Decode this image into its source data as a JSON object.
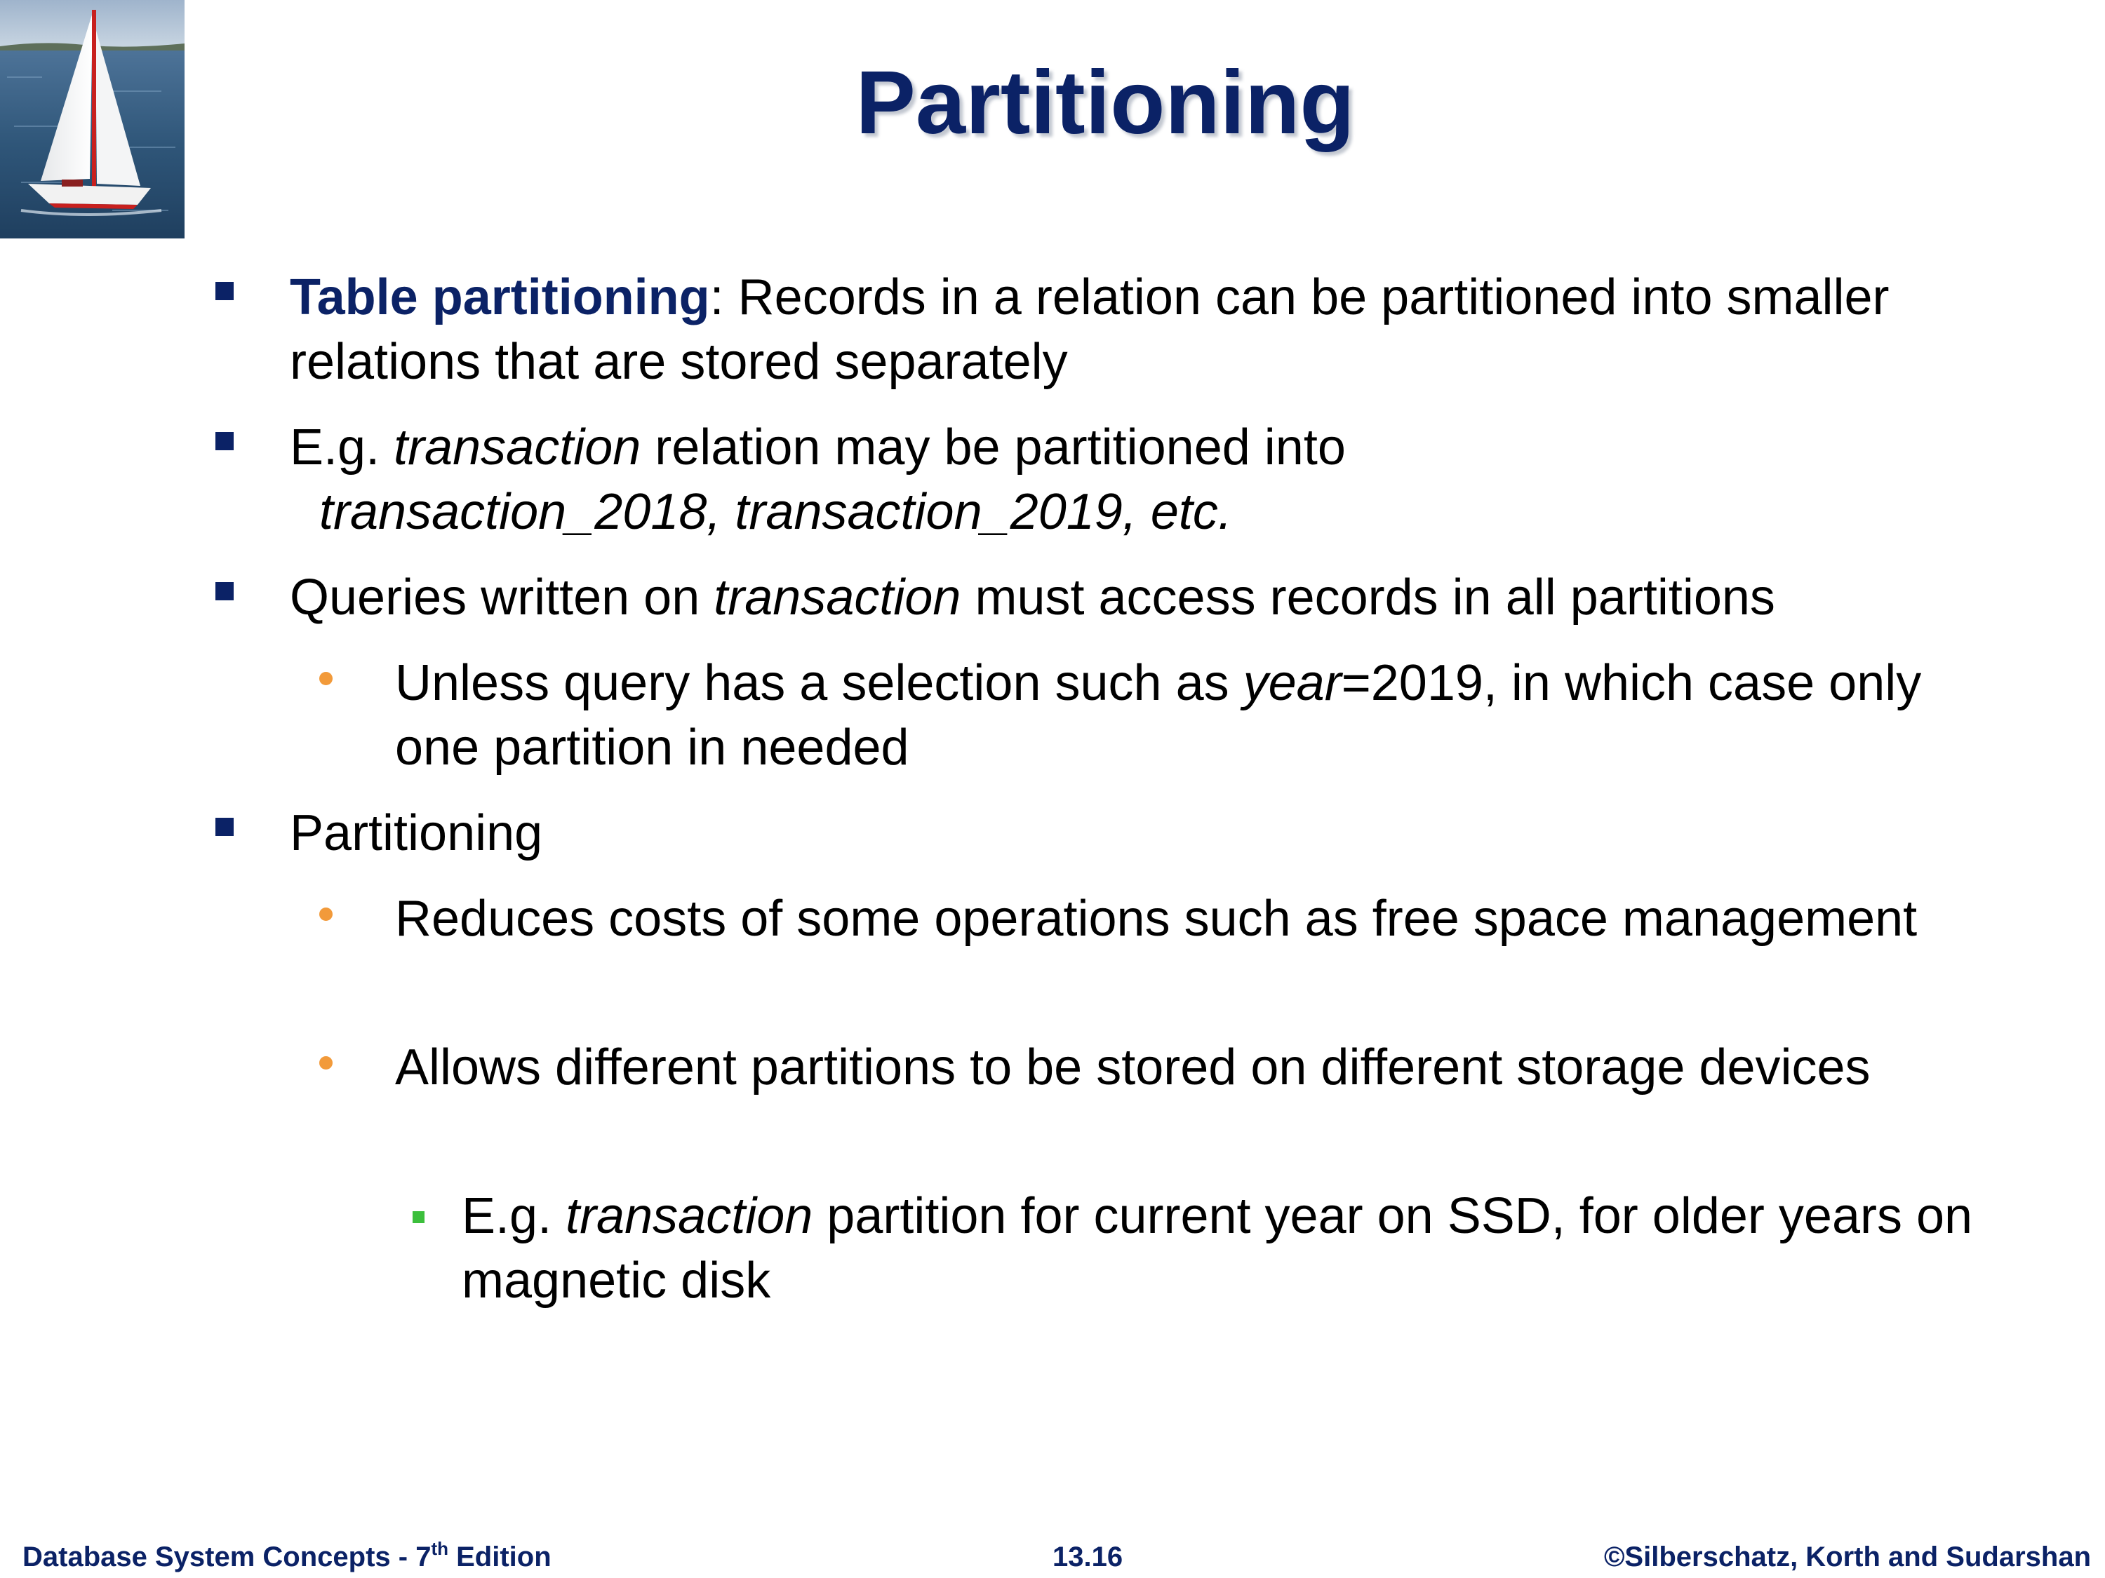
{
  "title": "Partitioning",
  "bullets": {
    "b1": {
      "term": "Table partitioning",
      "rest": ": Records in a relation can be partitioned into smaller relations that are stored separately"
    },
    "b2": {
      "pre": "E.g. ",
      "italic": "transaction",
      "rest": " relation may be partitioned into",
      "line2_italic": "transaction_2018, transaction_2019, etc."
    },
    "b3": {
      "pre": "Queries written on ",
      "italic": "transaction",
      "rest": " must access records in all partitions"
    },
    "b3_1": {
      "pre": "Unless query has a selection such as ",
      "italic": "year",
      "rest": "=2019, in which case only one partition in needed"
    },
    "b4": {
      "text": "Partitioning"
    },
    "b4_1": {
      "text": "Reduces costs of some operations such as free space management"
    },
    "b4_2": {
      "text": "Allows different partitions to be stored on different storage devices"
    },
    "b4_2_1": {
      "pre": "E.g. ",
      "italic": "transaction",
      "rest": " partition for current year on SSD, for older years on magnetic disk"
    }
  },
  "footer": {
    "book": "Database System Concepts - 7",
    "book_sup": "th",
    "book_suffix": " Edition",
    "page": "13.16",
    "copyright": "©Silberschatz, Korth and Sudarshan"
  },
  "colors": {
    "title": "#0b2266",
    "level1_marker": "#0b2266",
    "level2_marker": "#f29a3a",
    "level3_marker": "#3cbf3c",
    "footer": "#0b2266"
  },
  "icons": {
    "corner_image": "sailboat-photo"
  }
}
